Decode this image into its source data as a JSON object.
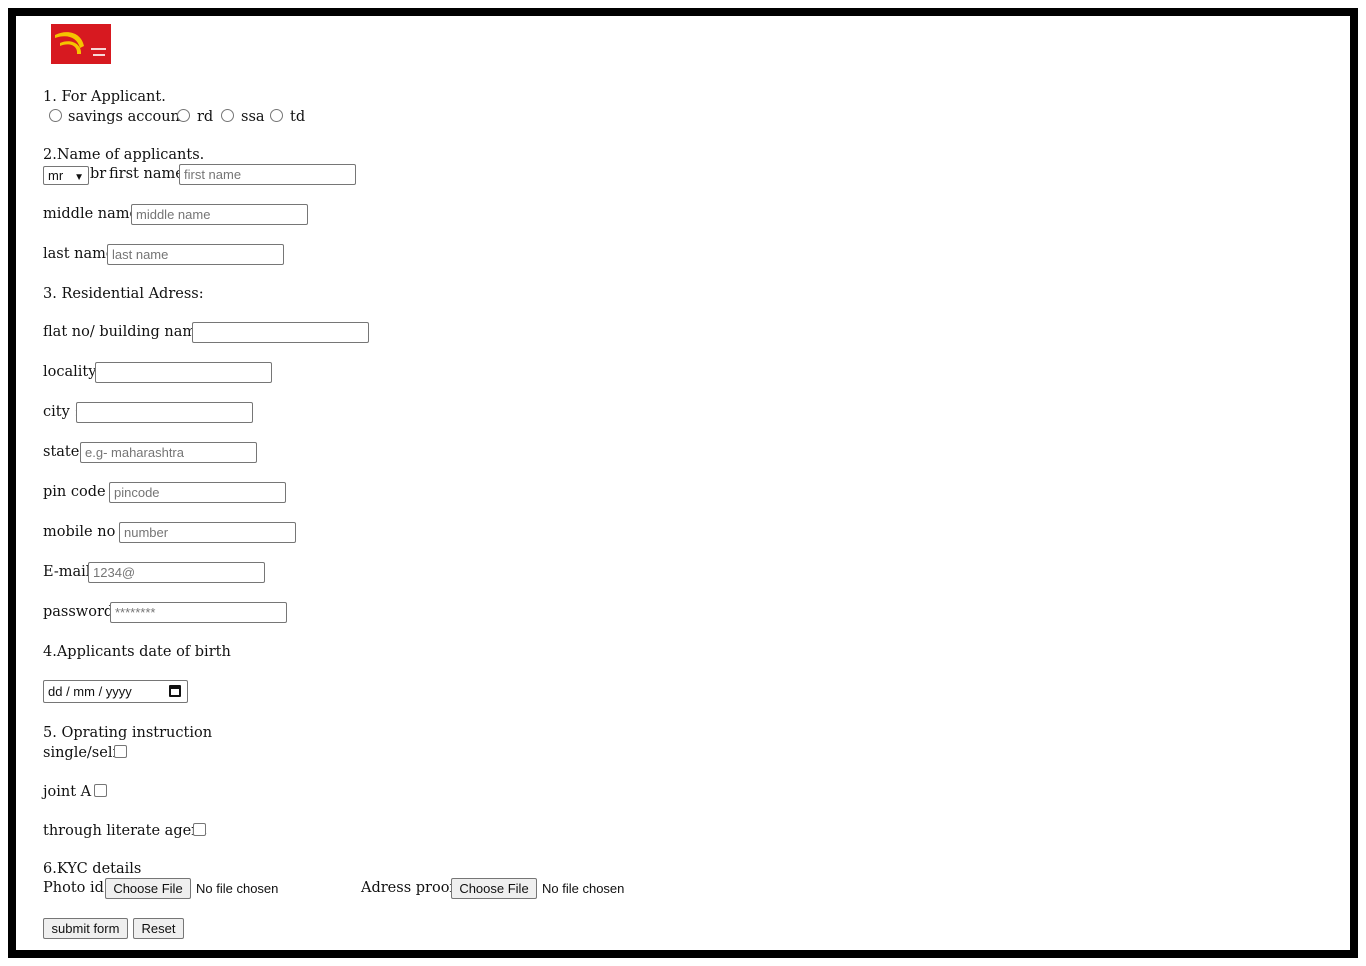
{
  "logo": {
    "alt_text": "India Post logo",
    "background": "#d71920",
    "mark_color": "#f5c400"
  },
  "section1": {
    "heading": "1. For Applicant.",
    "options": [
      {
        "label": "savings account",
        "selected": false
      },
      {
        "label": "rd",
        "selected": false
      },
      {
        "label": "ssa",
        "selected": false
      },
      {
        "label": "td",
        "selected": false
      }
    ]
  },
  "section2": {
    "heading": "2.Name of applicants.",
    "title_select": {
      "value": "mr"
    },
    "br_text": "br",
    "first_name": {
      "label": "first name:",
      "placeholder": "first name",
      "value": ""
    },
    "middle_name": {
      "label": "middle name:",
      "placeholder": "middle name",
      "value": ""
    },
    "last_name": {
      "label": "last name:",
      "placeholder": "last name",
      "value": ""
    }
  },
  "section3": {
    "heading": "3. Residential Adress:",
    "flat": {
      "label": "flat no/ building name :",
      "placeholder": "",
      "value": ""
    },
    "locality": {
      "label": "locality:",
      "placeholder": "",
      "value": ""
    },
    "city": {
      "label": "city :",
      "placeholder": "",
      "value": ""
    },
    "state": {
      "label": "state:",
      "placeholder": "e.g- maharashtra",
      "value": ""
    },
    "pin": {
      "label": "pin code :",
      "placeholder": "pincode",
      "value": ""
    },
    "mobile": {
      "label": "mobile no :",
      "placeholder": "number",
      "value": ""
    },
    "email": {
      "label": "E-mail:",
      "placeholder": "1234@",
      "value": ""
    },
    "password": {
      "label": "password:",
      "placeholder": "********",
      "value": ""
    }
  },
  "section4": {
    "heading": "4.Applicants date of birth",
    "date_placeholder": "dd / mm / yyyy"
  },
  "section5": {
    "heading": "5. Oprating instruction",
    "options": [
      {
        "label": "single/self",
        "checked": false
      },
      {
        "label": "joint A",
        "checked": false
      },
      {
        "label": "through literate agent",
        "checked": false
      }
    ]
  },
  "section6": {
    "heading": "6.KYC details",
    "photo_id": {
      "label": "Photo id:",
      "button": "Choose File",
      "status": "No file chosen"
    },
    "address_proof": {
      "label": "Adress proof:",
      "button": "Choose File",
      "status": "No file chosen"
    }
  },
  "actions": {
    "submit": "submit form",
    "reset": "Reset"
  }
}
